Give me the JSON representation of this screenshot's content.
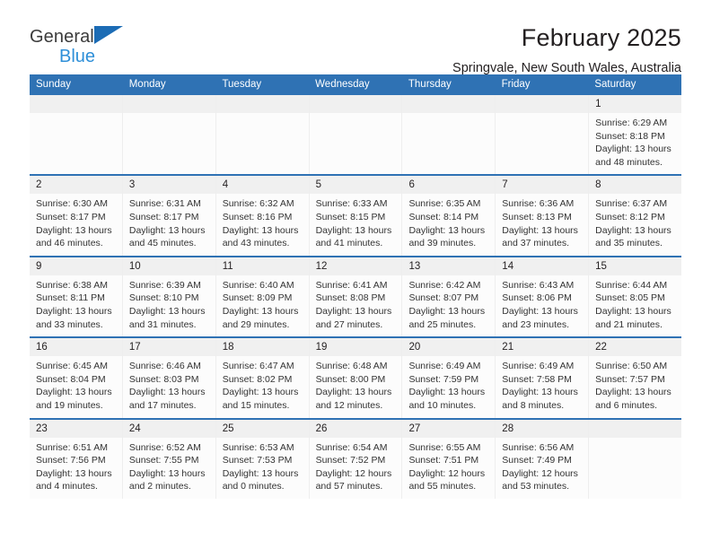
{
  "brand": {
    "name_top": "General",
    "name_bottom": "Blue",
    "triangle_color": "#1c6cb5",
    "bottom_color": "#2e8fd8"
  },
  "header": {
    "title": "February 2025",
    "subtitle": "Springvale, New South Wales, Australia",
    "accent_color": "#2f72b4"
  },
  "calendar": {
    "weekdays": [
      "Sunday",
      "Monday",
      "Tuesday",
      "Wednesday",
      "Thursday",
      "Friday",
      "Saturday"
    ],
    "weeks": [
      [
        {
          "day": "",
          "sunrise": "",
          "sunset": "",
          "daylight": "",
          "empty": true
        },
        {
          "day": "",
          "sunrise": "",
          "sunset": "",
          "daylight": "",
          "empty": true
        },
        {
          "day": "",
          "sunrise": "",
          "sunset": "",
          "daylight": "",
          "empty": true
        },
        {
          "day": "",
          "sunrise": "",
          "sunset": "",
          "daylight": "",
          "empty": true
        },
        {
          "day": "",
          "sunrise": "",
          "sunset": "",
          "daylight": "",
          "empty": true
        },
        {
          "day": "",
          "sunrise": "",
          "sunset": "",
          "daylight": "",
          "empty": true
        },
        {
          "day": "1",
          "sunrise": "Sunrise: 6:29 AM",
          "sunset": "Sunset: 8:18 PM",
          "daylight": "Daylight: 13 hours and 48 minutes.",
          "empty": false
        }
      ],
      [
        {
          "day": "2",
          "sunrise": "Sunrise: 6:30 AM",
          "sunset": "Sunset: 8:17 PM",
          "daylight": "Daylight: 13 hours and 46 minutes.",
          "empty": false
        },
        {
          "day": "3",
          "sunrise": "Sunrise: 6:31 AM",
          "sunset": "Sunset: 8:17 PM",
          "daylight": "Daylight: 13 hours and 45 minutes.",
          "empty": false
        },
        {
          "day": "4",
          "sunrise": "Sunrise: 6:32 AM",
          "sunset": "Sunset: 8:16 PM",
          "daylight": "Daylight: 13 hours and 43 minutes.",
          "empty": false
        },
        {
          "day": "5",
          "sunrise": "Sunrise: 6:33 AM",
          "sunset": "Sunset: 8:15 PM",
          "daylight": "Daylight: 13 hours and 41 minutes.",
          "empty": false
        },
        {
          "day": "6",
          "sunrise": "Sunrise: 6:35 AM",
          "sunset": "Sunset: 8:14 PM",
          "daylight": "Daylight: 13 hours and 39 minutes.",
          "empty": false
        },
        {
          "day": "7",
          "sunrise": "Sunrise: 6:36 AM",
          "sunset": "Sunset: 8:13 PM",
          "daylight": "Daylight: 13 hours and 37 minutes.",
          "empty": false
        },
        {
          "day": "8",
          "sunrise": "Sunrise: 6:37 AM",
          "sunset": "Sunset: 8:12 PM",
          "daylight": "Daylight: 13 hours and 35 minutes.",
          "empty": false
        }
      ],
      [
        {
          "day": "9",
          "sunrise": "Sunrise: 6:38 AM",
          "sunset": "Sunset: 8:11 PM",
          "daylight": "Daylight: 13 hours and 33 minutes.",
          "empty": false
        },
        {
          "day": "10",
          "sunrise": "Sunrise: 6:39 AM",
          "sunset": "Sunset: 8:10 PM",
          "daylight": "Daylight: 13 hours and 31 minutes.",
          "empty": false
        },
        {
          "day": "11",
          "sunrise": "Sunrise: 6:40 AM",
          "sunset": "Sunset: 8:09 PM",
          "daylight": "Daylight: 13 hours and 29 minutes.",
          "empty": false
        },
        {
          "day": "12",
          "sunrise": "Sunrise: 6:41 AM",
          "sunset": "Sunset: 8:08 PM",
          "daylight": "Daylight: 13 hours and 27 minutes.",
          "empty": false
        },
        {
          "day": "13",
          "sunrise": "Sunrise: 6:42 AM",
          "sunset": "Sunset: 8:07 PM",
          "daylight": "Daylight: 13 hours and 25 minutes.",
          "empty": false
        },
        {
          "day": "14",
          "sunrise": "Sunrise: 6:43 AM",
          "sunset": "Sunset: 8:06 PM",
          "daylight": "Daylight: 13 hours and 23 minutes.",
          "empty": false
        },
        {
          "day": "15",
          "sunrise": "Sunrise: 6:44 AM",
          "sunset": "Sunset: 8:05 PM",
          "daylight": "Daylight: 13 hours and 21 minutes.",
          "empty": false
        }
      ],
      [
        {
          "day": "16",
          "sunrise": "Sunrise: 6:45 AM",
          "sunset": "Sunset: 8:04 PM",
          "daylight": "Daylight: 13 hours and 19 minutes.",
          "empty": false
        },
        {
          "day": "17",
          "sunrise": "Sunrise: 6:46 AM",
          "sunset": "Sunset: 8:03 PM",
          "daylight": "Daylight: 13 hours and 17 minutes.",
          "empty": false
        },
        {
          "day": "18",
          "sunrise": "Sunrise: 6:47 AM",
          "sunset": "Sunset: 8:02 PM",
          "daylight": "Daylight: 13 hours and 15 minutes.",
          "empty": false
        },
        {
          "day": "19",
          "sunrise": "Sunrise: 6:48 AM",
          "sunset": "Sunset: 8:00 PM",
          "daylight": "Daylight: 13 hours and 12 minutes.",
          "empty": false
        },
        {
          "day": "20",
          "sunrise": "Sunrise: 6:49 AM",
          "sunset": "Sunset: 7:59 PM",
          "daylight": "Daylight: 13 hours and 10 minutes.",
          "empty": false
        },
        {
          "day": "21",
          "sunrise": "Sunrise: 6:49 AM",
          "sunset": "Sunset: 7:58 PM",
          "daylight": "Daylight: 13 hours and 8 minutes.",
          "empty": false
        },
        {
          "day": "22",
          "sunrise": "Sunrise: 6:50 AM",
          "sunset": "Sunset: 7:57 PM",
          "daylight": "Daylight: 13 hours and 6 minutes.",
          "empty": false
        }
      ],
      [
        {
          "day": "23",
          "sunrise": "Sunrise: 6:51 AM",
          "sunset": "Sunset: 7:56 PM",
          "daylight": "Daylight: 13 hours and 4 minutes.",
          "empty": false
        },
        {
          "day": "24",
          "sunrise": "Sunrise: 6:52 AM",
          "sunset": "Sunset: 7:55 PM",
          "daylight": "Daylight: 13 hours and 2 minutes.",
          "empty": false
        },
        {
          "day": "25",
          "sunrise": "Sunrise: 6:53 AM",
          "sunset": "Sunset: 7:53 PM",
          "daylight": "Daylight: 13 hours and 0 minutes.",
          "empty": false
        },
        {
          "day": "26",
          "sunrise": "Sunrise: 6:54 AM",
          "sunset": "Sunset: 7:52 PM",
          "daylight": "Daylight: 12 hours and 57 minutes.",
          "empty": false
        },
        {
          "day": "27",
          "sunrise": "Sunrise: 6:55 AM",
          "sunset": "Sunset: 7:51 PM",
          "daylight": "Daylight: 12 hours and 55 minutes.",
          "empty": false
        },
        {
          "day": "28",
          "sunrise": "Sunrise: 6:56 AM",
          "sunset": "Sunset: 7:49 PM",
          "daylight": "Daylight: 12 hours and 53 minutes.",
          "empty": false
        },
        {
          "day": "",
          "sunrise": "",
          "sunset": "",
          "daylight": "",
          "empty": true
        }
      ]
    ]
  }
}
